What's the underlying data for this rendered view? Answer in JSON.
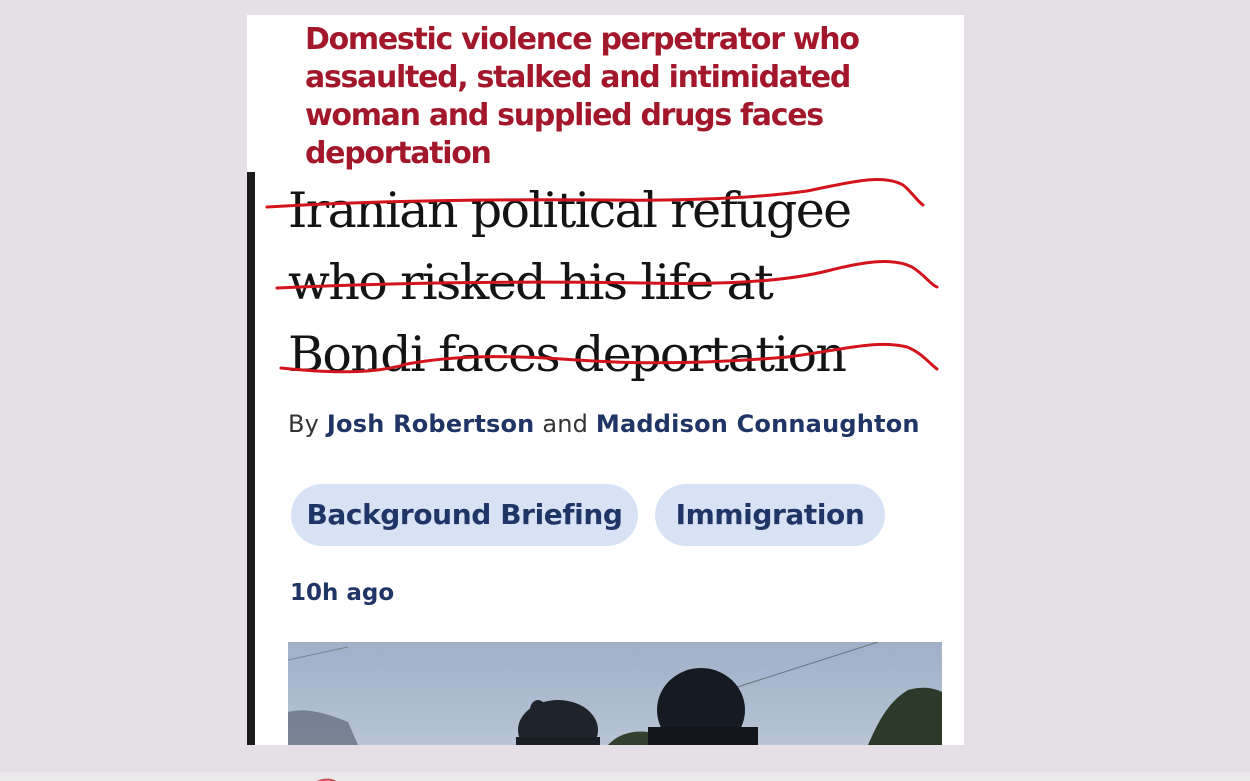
{
  "overlay_headline": {
    "lines": [
      "Domestic violence perpetrator who",
      "assaulted, stalked and intimidated",
      "woman and supplied drugs faces",
      "deportation"
    ],
    "color": "#a3172b"
  },
  "original_headline": {
    "lines": [
      "Iranian political refugee",
      "who risked his life at",
      "Bondi faces deportation"
    ],
    "strikethrough_color": "#d4141c"
  },
  "byline": {
    "prefix": "By",
    "author_1": "Josh Robertson",
    "conjunction": "and",
    "author_2": "Maddison Connaughton"
  },
  "tags": [
    {
      "label": "Background Briefing"
    },
    {
      "label": "Immigration"
    }
  ],
  "timestamp": "10h ago",
  "colors": {
    "background": "#e5e0e5",
    "card": "#ffffff",
    "link_navy": "#1f3566",
    "tag_background": "#d7e2f5"
  }
}
